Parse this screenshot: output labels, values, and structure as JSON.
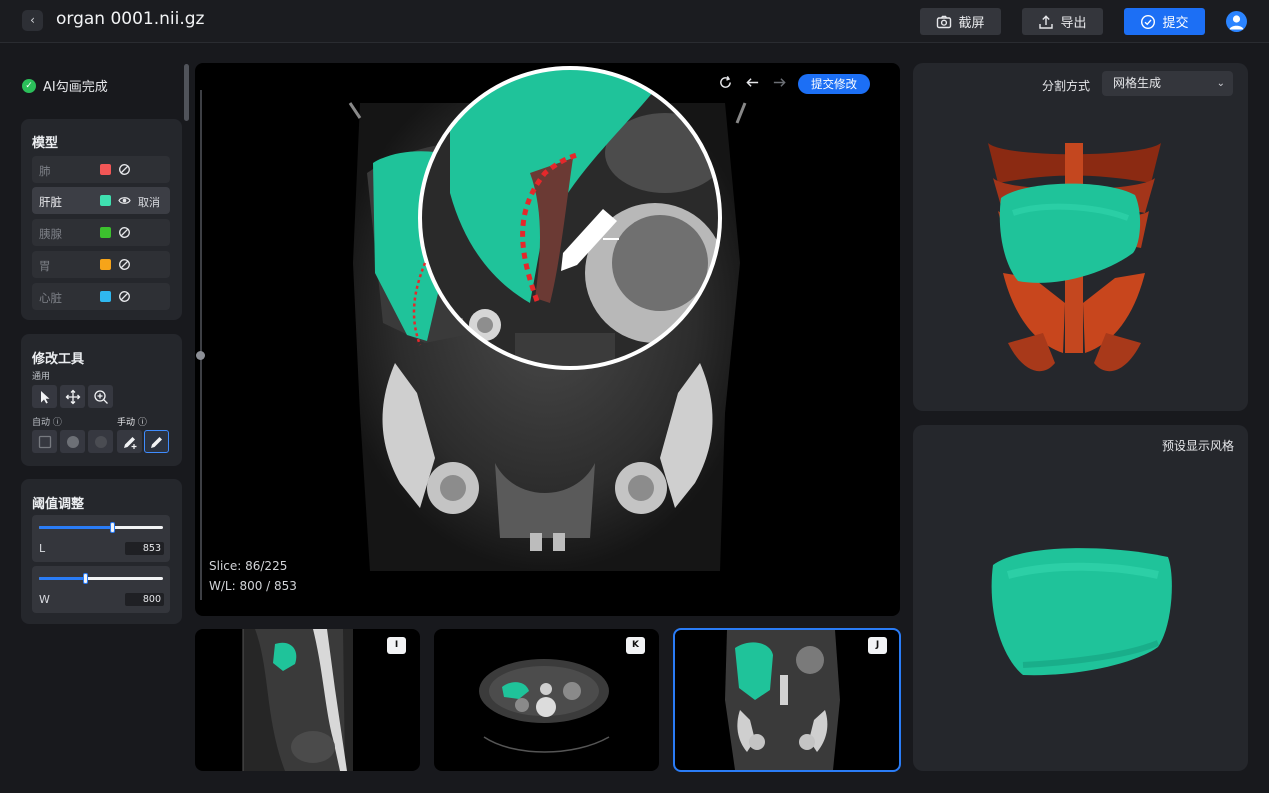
{
  "header": {
    "title": "organ 0001.nii.gz",
    "screenshot_label": "截屏",
    "export_label": "导出",
    "submit_label": "提交"
  },
  "status": {
    "text": "AI勾画完成"
  },
  "models": {
    "title": "模型",
    "cancel_label": "取消",
    "items": [
      {
        "name": "肺",
        "color": "#f25656"
      },
      {
        "name": "肝脏",
        "color": "#3fe0b0"
      },
      {
        "name": "胰腺",
        "color": "#3cc12e"
      },
      {
        "name": "胃",
        "color": "#f6a419"
      },
      {
        "name": "心脏",
        "color": "#2fb8f0"
      }
    ]
  },
  "tools": {
    "title": "修改工具",
    "general_label": "通用",
    "auto_label": "自动",
    "manual_label": "手动"
  },
  "threshold": {
    "title": "阈值调整",
    "L": {
      "label": "L",
      "value": "853",
      "position": 0.59
    },
    "W": {
      "label": "W",
      "value": "800",
      "position": 0.37
    }
  },
  "viewer": {
    "submit_edit_label": "提交修改",
    "slice_text": "Slice: 86/225",
    "wl_text": "W/L: 800 / 853",
    "slice_position": 0.52
  },
  "thumbs": [
    {
      "tag": "I"
    },
    {
      "tag": "K"
    },
    {
      "tag": "J"
    }
  ],
  "right": {
    "seg_label": "分割方式",
    "seg_value": "网格生成",
    "preset_label": "预设显示风格"
  },
  "colors": {
    "accent": "#1c6ff5",
    "liver": "#1fc39a",
    "bone": "#c9411b"
  }
}
